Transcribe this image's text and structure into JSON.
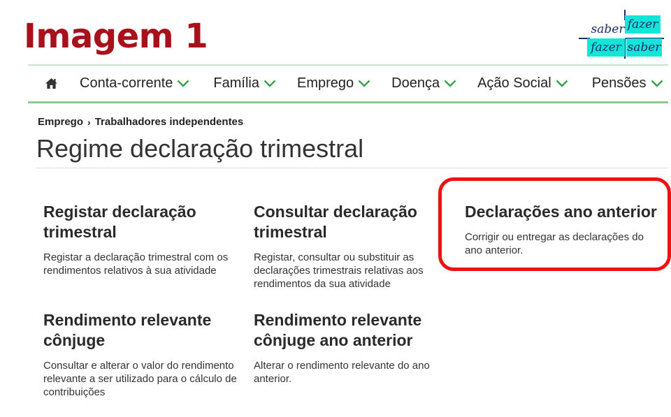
{
  "banner": {
    "title": "Imagem 1"
  },
  "logo": {
    "top_left": "saber",
    "top_right": "fazer",
    "bottom_left": "fazer",
    "bottom_right": "saber"
  },
  "nav": {
    "home_icon": "home-icon",
    "items": [
      {
        "label": "Conta-corrente"
      },
      {
        "label": "Família"
      },
      {
        "label": "Emprego"
      },
      {
        "label": "Doença"
      },
      {
        "label": "Ação Social"
      },
      {
        "label": "Pensões"
      }
    ],
    "chevron_color": "#3aa04a"
  },
  "breadcrumb": {
    "items": [
      "Emprego",
      "Trabalhadores independentes"
    ]
  },
  "page": {
    "title": "Regime declaração trimestral"
  },
  "cards": [
    {
      "title": "Registar declaração trimestral",
      "description": "Registar a declaração trimestral com os rendimentos relativos à sua atividade"
    },
    {
      "title": "Consultar declaração trimestral",
      "description": "Registar, consultar ou substituir as declarações trimestrais relativas aos rendimentos da sua atividade"
    },
    {
      "title": "Declarações ano anterior",
      "description": "Corrigir ou entregar as declarações do ano anterior."
    },
    {
      "title": "Rendimento relevante cônjuge",
      "description": "Consultar e alterar o valor do rendimento relevante a ser utilizado para o cálculo de contribuições"
    },
    {
      "title": "Rendimento relevante cônjuge ano anterior",
      "description": "Alterar o rendimento relevante do ano anterior."
    }
  ],
  "colors": {
    "accent": "#ee1111",
    "brand_red": "#a8101a",
    "logo_cyan": "#13e6d9",
    "nav_border": "#8fca94"
  }
}
